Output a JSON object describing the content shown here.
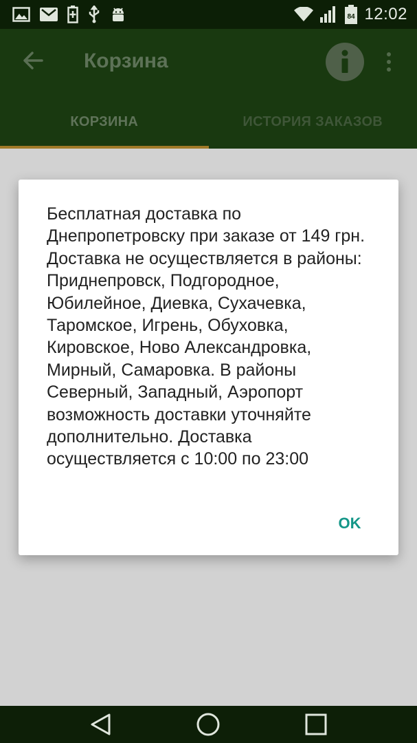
{
  "status_bar": {
    "time": "12:02",
    "battery_level": "84",
    "left_icons": [
      "image-icon",
      "gmail-icon",
      "battery-saver-icon",
      "usb-icon",
      "android-debug-icon"
    ],
    "right_icons": [
      "wifi-icon",
      "signal-icon",
      "battery-icon"
    ]
  },
  "toolbar": {
    "title": "Корзина",
    "back_icon": "arrow-back-icon",
    "info_icon": "info-icon",
    "more_icon": "more-vert-icon"
  },
  "tabs": [
    {
      "label": "КОРЗИНА",
      "active": true
    },
    {
      "label": "ИСТОРИЯ ЗАКАЗОВ",
      "active": false
    }
  ],
  "dialog": {
    "message": "Бесплатная доставка по Днепропетровску при заказе от 149 грн. Доставка не осуществляется в районы: Приднепровск, Подгородное, Юбилейное, Диевка, Сухачевка, Таромское, Игрень, Обуховка, Кировское, Ново Александровка, Мирный, Самаровка. В районы Северный, Западный, Аэропорт возможность доставки уточняйте дополнительно. Доставка осуществляется с 10:00 по 23:00",
    "ok_label": "OK"
  },
  "nav_bar": {
    "icons": [
      "back-triangle-icon",
      "home-circle-icon",
      "recents-square-icon"
    ]
  },
  "colors": {
    "status_bar": "#0c1f06",
    "app_bar": "#193910",
    "tab_indicator": "#a07a28",
    "dialog_button": "#149688",
    "scrim_background": "#d2d2d2"
  }
}
